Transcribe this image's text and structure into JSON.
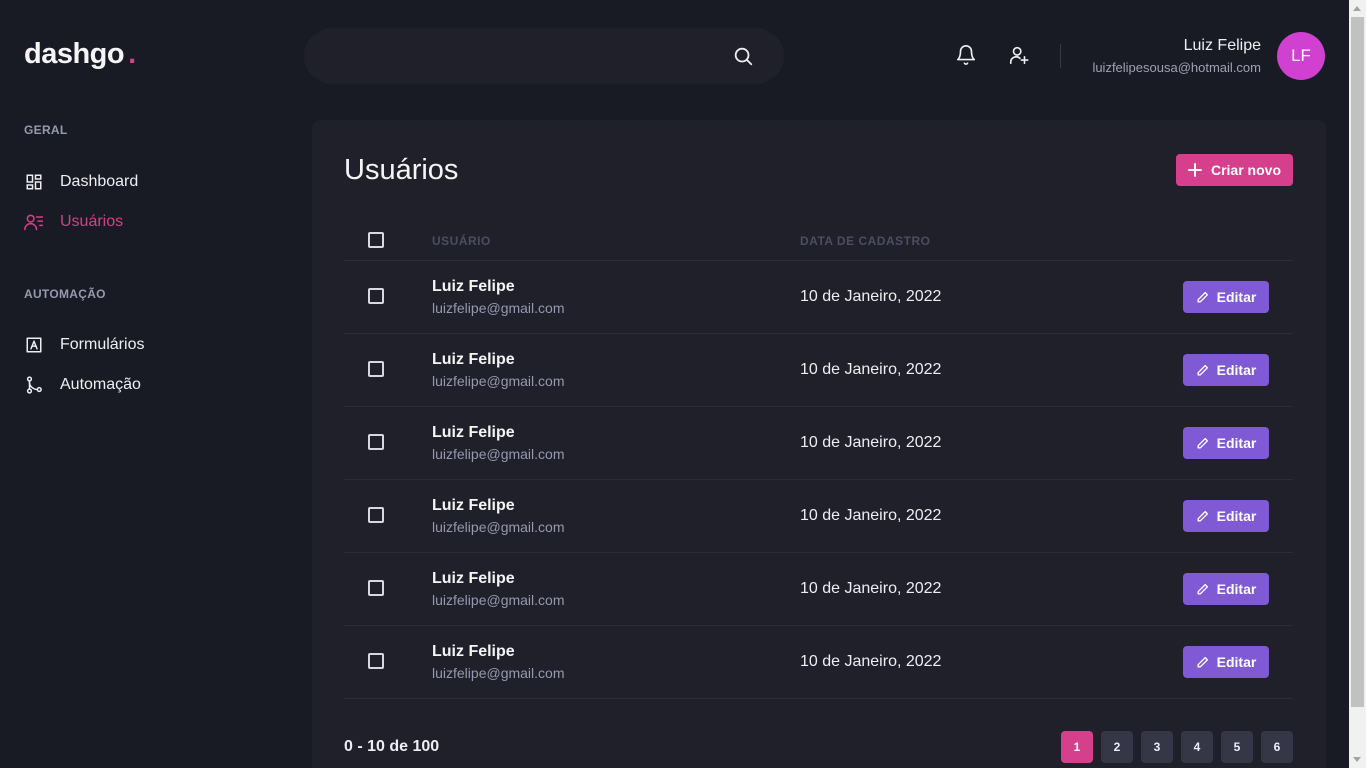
{
  "header": {
    "logo": "dashgo",
    "logo_dot": ".",
    "search": {
      "placeholder": "",
      "value": ""
    },
    "user": {
      "name": "Luiz Felipe",
      "email": "luizfelipesousa@hotmail.com",
      "initials": "LF"
    }
  },
  "sidebar": {
    "sections": [
      {
        "title": "GERAL",
        "items": [
          {
            "label": "Dashboard",
            "icon": "dashboard-icon"
          },
          {
            "label": "Usuários",
            "icon": "users-icon",
            "active": true
          }
        ]
      },
      {
        "title": "AUTOMAÇÃO",
        "items": [
          {
            "label": "Formulários",
            "icon": "form-icon"
          },
          {
            "label": "Automação",
            "icon": "git-merge-icon"
          }
        ]
      }
    ]
  },
  "main": {
    "title": "Usuários",
    "create_label": "Criar novo",
    "columns": {
      "user": "USUÁRIO",
      "date": "DATA DE CADASTRO"
    },
    "rows": [
      {
        "name": "Luiz Felipe",
        "email": "luizfelipe@gmail.com",
        "date": "10 de Janeiro, 2022",
        "edit_label": "Editar"
      },
      {
        "name": "Luiz Felipe",
        "email": "luizfelipe@gmail.com",
        "date": "10 de Janeiro, 2022",
        "edit_label": "Editar"
      },
      {
        "name": "Luiz Felipe",
        "email": "luizfelipe@gmail.com",
        "date": "10 de Janeiro, 2022",
        "edit_label": "Editar"
      },
      {
        "name": "Luiz Felipe",
        "email": "luizfelipe@gmail.com",
        "date": "10 de Janeiro, 2022",
        "edit_label": "Editar"
      },
      {
        "name": "Luiz Felipe",
        "email": "luizfelipe@gmail.com",
        "date": "10 de Janeiro, 2022",
        "edit_label": "Editar"
      },
      {
        "name": "Luiz Felipe",
        "email": "luizfelipe@gmail.com",
        "date": "10 de Janeiro, 2022",
        "edit_label": "Editar"
      }
    ],
    "pagination": {
      "summary": "0 - 10 de 100",
      "pages": [
        "1",
        "2",
        "3",
        "4",
        "5",
        "6"
      ],
      "current": "1"
    }
  },
  "colors": {
    "background": "#181b23",
    "card": "#1f2029",
    "accent_pink": "#d53f8c",
    "accent_purple": "#805ad5",
    "avatar": "#d041d1",
    "muted_text": "#9699b0"
  }
}
